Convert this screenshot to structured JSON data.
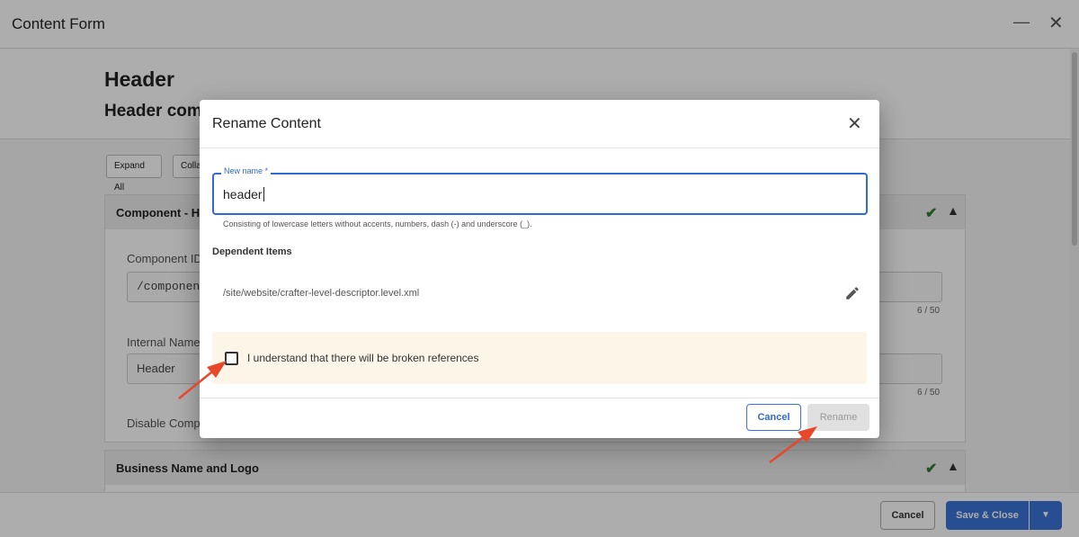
{
  "window": {
    "title": "Content Form",
    "minimize_icon": "minimize-icon",
    "close_icon": "close-icon"
  },
  "form": {
    "title": "Header",
    "subtitle": "Header comp",
    "expand_all_label": "Expand All",
    "collapse_all_label": "Colla",
    "sections": [
      {
        "title": "Component - He",
        "fields": [
          {
            "label": "Component ID",
            "value": "/component:",
            "counter": "6 / 50"
          },
          {
            "label": "Internal Name",
            "value": "Header",
            "counter": "6 / 50"
          },
          {
            "label": "Disable Compo"
          }
        ]
      },
      {
        "title": "Business Name and Logo"
      }
    ]
  },
  "footer": {
    "cancel_label": "Cancel",
    "save_close_label": "Save & Close",
    "dropdown_icon": "caret-down-icon"
  },
  "modal": {
    "title": "Rename Content",
    "new_name_label": "New name *",
    "new_name_value": "header",
    "helper_text": "Consisting of lowercase letters without accents, numbers, dash (-) and underscore (_).",
    "dependent_items_title": "Dependent Items",
    "dependent_items": [
      "/site/website/crafter-level-descriptor.level.xml"
    ],
    "confirm_checkbox_label": "I understand that there will be broken references",
    "confirm_checked": false,
    "cancel_label": "Cancel",
    "rename_label": "Rename",
    "rename_enabled": false
  },
  "colors": {
    "primary": "#3b73d8",
    "success_check": "#2e7d32",
    "warning_bg": "#fdf5e8",
    "annotation_arrow": "#e8472a"
  }
}
